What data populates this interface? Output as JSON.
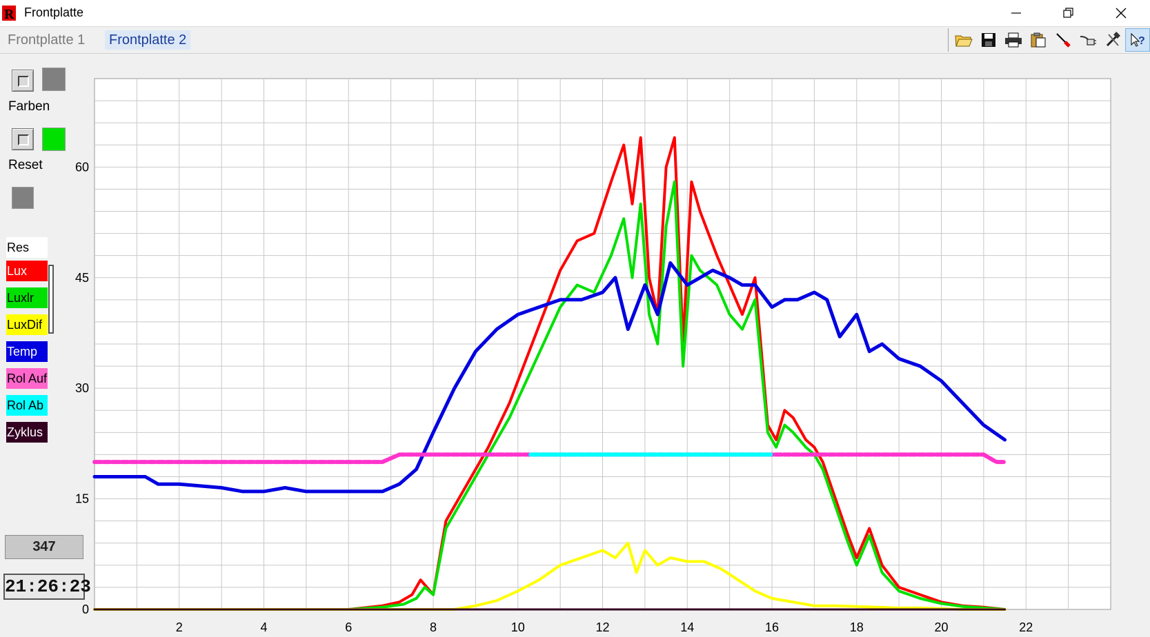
{
  "window": {
    "title": "Frontplatte"
  },
  "tabs": [
    {
      "label": "Frontplatte 1"
    },
    {
      "label": "Frontplatte 2"
    }
  ],
  "toolbar_icons": [
    "open-folder-icon",
    "save-icon",
    "print-icon",
    "clipboard-icon",
    "marker-icon",
    "plug-icon",
    "tools-icon",
    "help-icon"
  ],
  "controls": {
    "farben_label": "Farben",
    "reset_label": "Reset",
    "farben_swatch": "#808080",
    "reset_swatch": "#00e000"
  },
  "legend": {
    "header": "Res",
    "items": [
      {
        "label": "Lux",
        "color": "#ff0000",
        "text_color": "#ffffff"
      },
      {
        "label": "Luxlr",
        "color": "#00e000",
        "text_color": "#000000"
      },
      {
        "label": "LuxDif",
        "color": "#ffff00",
        "text_color": "#000000"
      },
      {
        "label": "Temp",
        "color": "#0000e0",
        "text_color": "#ffffff"
      },
      {
        "label": "Rol Auf",
        "color": "#ff66cc",
        "text_color": "#000000"
      },
      {
        "label": "Rol Ab",
        "color": "#00ffff",
        "text_color": "#000000"
      },
      {
        "label": "Zyklus",
        "color": "#330022",
        "text_color": "#ffffff"
      }
    ]
  },
  "status": {
    "count": "347",
    "time": "21:26:23"
  },
  "chart_data": {
    "type": "line",
    "xlim": [
      0,
      24
    ],
    "ylim": [
      0,
      72
    ],
    "x_ticks": [
      "2",
      "4",
      "6",
      "8",
      "10",
      "12",
      "14",
      "16",
      "18",
      "20",
      "22"
    ],
    "y_ticks": [
      "0",
      "15",
      "30",
      "45",
      "60"
    ],
    "grid": true,
    "series": [
      {
        "name": "Lux",
        "color": "#ff0000",
        "x": [
          0,
          6.0,
          6.8,
          7.2,
          7.5,
          7.7,
          8.0,
          8.3,
          8.8,
          9.3,
          9.8,
          10.2,
          10.6,
          11.0,
          11.4,
          11.8,
          12.2,
          12.5,
          12.7,
          12.9,
          13.1,
          13.3,
          13.5,
          13.7,
          13.9,
          14.1,
          14.3,
          14.5,
          14.7,
          15.0,
          15.3,
          15.6,
          15.9,
          16.1,
          16.3,
          16.5,
          16.8,
          17.0,
          17.2,
          17.5,
          17.8,
          18.0,
          18.3,
          18.6,
          19.0,
          19.5,
          20.0,
          20.5,
          21.0,
          21.5
        ],
        "y": [
          0,
          0,
          0.5,
          1,
          2,
          4,
          2,
          12,
          17,
          22,
          28,
          34,
          40,
          46,
          50,
          51,
          58,
          63,
          55,
          64,
          45,
          40,
          60,
          64,
          36,
          58,
          54,
          51,
          48,
          44,
          40,
          45,
          25,
          23,
          27,
          26,
          23,
          22,
          20,
          15,
          10,
          7,
          11,
          6,
          3,
          2,
          1,
          0.5,
          0.3,
          0
        ]
      },
      {
        "name": "Luxlr",
        "color": "#00e000",
        "x": [
          0,
          6.0,
          6.8,
          7.3,
          7.6,
          7.8,
          8.0,
          8.3,
          8.8,
          9.3,
          9.8,
          10.2,
          10.6,
          11.0,
          11.4,
          11.8,
          12.2,
          12.5,
          12.7,
          12.9,
          13.1,
          13.3,
          13.5,
          13.7,
          13.9,
          14.1,
          14.3,
          14.5,
          14.7,
          15.0,
          15.3,
          15.6,
          15.9,
          16.1,
          16.3,
          16.5,
          16.8,
          17.0,
          17.2,
          17.5,
          17.8,
          18.0,
          18.3,
          18.6,
          19.0,
          19.5,
          20.0,
          20.5,
          21.0,
          21.5
        ],
        "y": [
          0,
          0,
          0.3,
          0.7,
          1.5,
          3,
          2,
          11,
          16,
          21,
          26,
          31,
          36,
          41,
          44,
          43,
          48,
          53,
          45,
          55,
          40,
          36,
          52,
          58,
          33,
          48,
          46,
          45,
          44,
          40,
          38,
          42,
          24,
          22,
          25,
          24,
          22,
          21,
          19,
          14,
          9,
          6,
          10,
          5,
          2.5,
          1.5,
          0.8,
          0.4,
          0.2,
          0
        ]
      },
      {
        "name": "LuxDif",
        "color": "#ffff00",
        "x": [
          0,
          8.5,
          9.0,
          9.5,
          10.0,
          10.5,
          11.0,
          11.5,
          12.0,
          12.3,
          12.6,
          12.8,
          13.0,
          13.3,
          13.6,
          14.0,
          14.4,
          14.8,
          15.2,
          15.6,
          16.0,
          16.5,
          17.0,
          17.5,
          18.0,
          18.5,
          19.0,
          19.5,
          20.0,
          20.5,
          21.0,
          21.5
        ],
        "y": [
          0,
          0,
          0.5,
          1.2,
          2.5,
          4,
          6,
          7,
          8,
          7,
          9,
          5,
          8,
          6,
          7,
          6.5,
          6.5,
          5.5,
          4,
          2.5,
          1.5,
          1,
          0.5,
          0.5,
          0.4,
          0.3,
          0.2,
          0.2,
          0.1,
          0,
          0,
          0
        ]
      },
      {
        "name": "Temp",
        "color": "#0000e0",
        "x": [
          0,
          1.2,
          1.5,
          2.0,
          3.0,
          3.5,
          4.0,
          4.5,
          5.0,
          5.5,
          6.0,
          6.5,
          6.8,
          7.2,
          7.6,
          8.0,
          8.5,
          9.0,
          9.5,
          10.0,
          10.5,
          11.0,
          11.5,
          12.0,
          12.3,
          12.6,
          13.0,
          13.3,
          13.6,
          14.0,
          14.3,
          14.6,
          15.0,
          15.3,
          15.6,
          16.0,
          16.3,
          16.6,
          17.0,
          17.3,
          17.6,
          18.0,
          18.3,
          18.6,
          19.0,
          19.5,
          20.0,
          20.5,
          21.0,
          21.5
        ],
        "y": [
          18,
          18,
          17,
          17,
          16.5,
          16,
          16,
          16.5,
          16,
          16,
          16,
          16,
          16,
          17,
          19,
          24,
          30,
          35,
          38,
          40,
          41,
          42,
          42,
          43,
          45,
          38,
          44,
          40,
          47,
          44,
          45,
          46,
          45,
          44,
          44,
          41,
          42,
          42,
          43,
          42,
          37,
          40,
          35,
          36,
          34,
          33,
          31,
          28,
          25,
          23
        ]
      },
      {
        "name": "Rol Auf",
        "color": "#ff33cc",
        "x": [
          0,
          6.8,
          7.2,
          10.3,
          16.0,
          20.0,
          20.3,
          21.0,
          21.3,
          21.5
        ],
        "y": [
          20,
          20,
          21,
          21,
          21,
          21,
          21,
          21,
          20,
          20
        ]
      },
      {
        "name": "Rol Ab",
        "color": "#00ffff",
        "x": [
          10.3,
          16.0
        ],
        "y": [
          21,
          21
        ]
      },
      {
        "name": "Zyklus",
        "color": "#330022",
        "x": [
          0,
          21.5
        ],
        "y": [
          0,
          0
        ]
      }
    ]
  }
}
